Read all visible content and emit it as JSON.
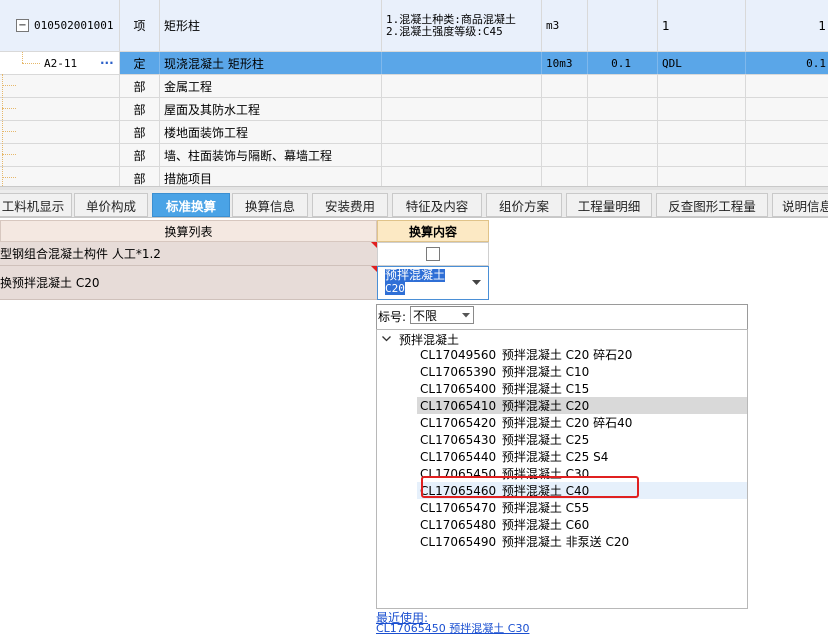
{
  "grid": {
    "rows": [
      {
        "code": "010502001001",
        "type": "项",
        "name": "矩形柱",
        "feature": [
          "1.混凝土种类:商品混凝土",
          "2.混凝土强度等级:C45"
        ],
        "unit": "m3",
        "qty": "",
        "price": "",
        "tail": "1",
        "tail2": "1"
      },
      {
        "code": "A2-11",
        "ellipsis": "···",
        "type": "定",
        "name": "现浇混凝土 矩形柱",
        "feature": [],
        "unit": "10m3",
        "qty": "0.1",
        "price": "QDL",
        "tail": "0.1"
      },
      {
        "type": "部",
        "name": "金属工程"
      },
      {
        "type": "部",
        "name": "屋面及其防水工程"
      },
      {
        "type": "部",
        "name": "楼地面装饰工程"
      },
      {
        "type": "部",
        "name": "墙、柱面装饰与隔断、幕墙工程"
      },
      {
        "type": "部",
        "name": "措施项目"
      }
    ],
    "toggle_symbol": "−"
  },
  "tabs": [
    "工料机显示",
    "单价构成",
    "标准换算",
    "换算信息",
    "安装费用",
    "特征及内容",
    "组价方案",
    "工程量明细",
    "反查图形工程量",
    "说明信息"
  ],
  "active_tab": "标准换算",
  "conv": {
    "list_header": "换算列表",
    "content_header": "换算内容",
    "rows": [
      {
        "label": "型钢组合混凝土构件 人工*1.2"
      },
      {
        "label": "换预拌混凝土 C20",
        "value_line1": "预拌混凝土",
        "value_line2": "C20"
      }
    ]
  },
  "dropdown": {
    "filter_label": "标号:",
    "filter_value": "不限",
    "group": "预拌混凝土",
    "items": [
      {
        "code": "CL17049560",
        "name": "预拌混凝土 C20 碎石20"
      },
      {
        "code": "CL17065390",
        "name": "预拌混凝土 C10"
      },
      {
        "code": "CL17065400",
        "name": "预拌混凝土 C15"
      },
      {
        "code": "CL17065410",
        "name": "预拌混凝土 C20"
      },
      {
        "code": "CL17065420",
        "name": "预拌混凝土 C20 碎石40"
      },
      {
        "code": "CL17065430",
        "name": "预拌混凝土 C25"
      },
      {
        "code": "CL17065440",
        "name": "预拌混凝土 C25 S4"
      },
      {
        "code": "CL17065450",
        "name": "预拌混凝土 C30"
      },
      {
        "code": "CL17065460",
        "name": "预拌混凝土 C40"
      },
      {
        "code": "CL17065470",
        "name": "预拌混凝土 C55"
      },
      {
        "code": "CL17065480",
        "name": "预拌混凝土 C60"
      },
      {
        "code": "CL17065490",
        "name": "预拌混凝土 非泵送 C20"
      }
    ],
    "recent_label": "最近使用:",
    "recent_value": "CL17065450 预拌混凝土 C30"
  },
  "colors": {
    "selected_row": "#5aa6e8",
    "active_tab": "#4aa3e6",
    "highlight_box": "#e02020",
    "hover_item": "#d9d9d9",
    "link": "#1a4fd0"
  }
}
